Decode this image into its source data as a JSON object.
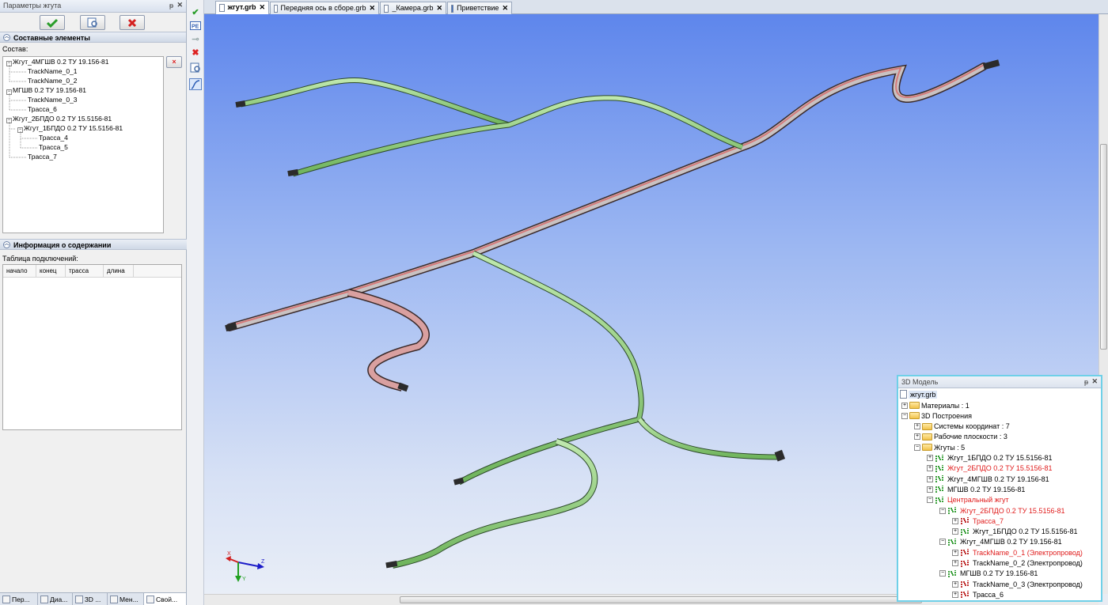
{
  "left_panel": {
    "title": "Параметры жгута",
    "pin": "ᵽ",
    "close": "✕",
    "toolbar": {
      "ok_icon": "check-icon",
      "preview_icon": "preview-icon",
      "cancel_icon": "cancel-icon"
    },
    "components_section": "Составные элементы",
    "composition_label": "Состав:",
    "tree": [
      {
        "label": "Жгут_4МГШВ 0.2 ТУ 19.156-81",
        "box": "−"
      },
      {
        "label": "TrackName_0_1"
      },
      {
        "label": "TrackName_0_2"
      },
      {
        "label": "МГШВ 0.2 ТУ 19.156-81",
        "box": "−"
      },
      {
        "label": "TrackName_0_3"
      },
      {
        "label": "Трасса_6"
      },
      {
        "label": "Жгут_2БПДО 0.2 ТУ 15.5156-81",
        "box": "−"
      },
      {
        "label": "Жгут_1БПДО 0.2 ТУ 15.5156-81",
        "box": "−"
      },
      {
        "label": "Трасса_4"
      },
      {
        "label": "Трасса_5"
      },
      {
        "label": "Трасса_7"
      }
    ],
    "remove_label": "×",
    "info_section": "Информация о содержании",
    "connections_label": "Таблица подключений:",
    "columns": [
      "начало",
      "конец",
      "трасса",
      "длина"
    ]
  },
  "bottom_tabs": [
    "Пер...",
    "Диа...",
    "3D ...",
    "Мен...",
    "Свой..."
  ],
  "doc_tabs": [
    {
      "label": "жгут.grb",
      "active": true
    },
    {
      "label": "Передняя ось в сборе.grb"
    },
    {
      "label": "_Камера.grb"
    },
    {
      "label": "Приветствие"
    }
  ],
  "tab_close": "✕",
  "model_panel": {
    "title": "3D Модель",
    "root": "жгут.grb",
    "items": [
      {
        "label": "Материалы : 1",
        "type": "folder",
        "pm": "+"
      },
      {
        "label": "3D Построения",
        "type": "folder",
        "pm": "−"
      },
      {
        "label": "Системы координат : 7",
        "type": "folder",
        "pm": "+"
      },
      {
        "label": "Рабочие плоскости : 3",
        "type": "folder",
        "pm": "+"
      },
      {
        "label": "Жгуты : 5",
        "type": "folder",
        "pm": "−"
      },
      {
        "label": "Жгут_1БПДО 0.2 ТУ 15.5156-81",
        "type": "harness",
        "pm": "+"
      },
      {
        "label": "Жгут_2БПДО 0.2 ТУ 15.5156-81",
        "type": "harness",
        "pm": "+",
        "red": true
      },
      {
        "label": "Жгут_4МГШВ 0.2 ТУ 19.156-81",
        "type": "harness",
        "pm": "+"
      },
      {
        "label": "МГШВ 0.2 ТУ 19.156-81",
        "type": "harness",
        "pm": "+"
      },
      {
        "label": "Центральный жгут",
        "type": "harness",
        "pm": "−",
        "red": true
      },
      {
        "label": "Жгут_2БПДО 0.2 ТУ 15.5156-81",
        "type": "harness",
        "pm": "−",
        "red": true
      },
      {
        "label": "Трасса_7",
        "type": "track",
        "pm": "+",
        "red": true
      },
      {
        "label": "Жгут_1БПДО 0.2 ТУ 15.5156-81",
        "type": "harness",
        "pm": "+"
      },
      {
        "label": "Жгут_4МГШВ 0.2 ТУ 19.156-81",
        "type": "harness",
        "pm": "−"
      },
      {
        "label": "TrackName_0_1 (Электропровод)",
        "type": "track",
        "pm": "+",
        "red": true
      },
      {
        "label": "TrackName_0_2 (Электропровод)",
        "type": "track",
        "pm": "+"
      },
      {
        "label": "МГШВ 0.2 ТУ 19.156-81",
        "type": "harness",
        "pm": "−"
      },
      {
        "label": "TrackName_0_3 (Электропровод)",
        "type": "track",
        "pm": "+"
      },
      {
        "label": "Трасса_6",
        "type": "track",
        "pm": "+"
      }
    ]
  },
  "axis_triad": {
    "x": "X",
    "y": "Y",
    "z": "Z"
  },
  "colors": {
    "green_wire": "#8fd07a",
    "red_wire": "#c98f8f",
    "viewport_top": "#5e86ec"
  }
}
